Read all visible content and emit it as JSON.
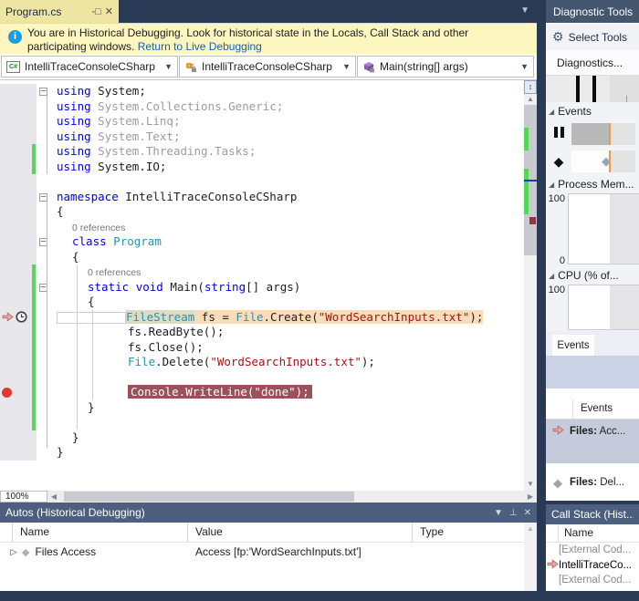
{
  "tab": {
    "title": "Program.cs",
    "pin_icon": "pin-icon",
    "close_icon": "close-icon"
  },
  "infobar": {
    "line1": "You are in Historical Debugging. Look for historical state in the Locals, Call Stack and other",
    "line2": "participating windows.",
    "link": "Return to Live Debugging",
    "icon": "info-icon"
  },
  "navbar": {
    "project": "IntelliTraceConsoleCSharp",
    "type": "IntelliTraceConsoleCSharp",
    "member": "Main(string[] args)"
  },
  "editor": {
    "zoom_label": "100%",
    "lines": [
      {
        "kind": "code",
        "ind": 0,
        "fold": true,
        "segs": [
          [
            "kw",
            "using"
          ],
          [
            "pl",
            " System;"
          ]
        ]
      },
      {
        "kind": "code",
        "ind": 0,
        "segs": [
          [
            "kw",
            "using"
          ],
          [
            "dim",
            " System.Collections.Generic;"
          ]
        ]
      },
      {
        "kind": "code",
        "ind": 0,
        "segs": [
          [
            "kw",
            "using"
          ],
          [
            "dim",
            " System.Linq;"
          ]
        ]
      },
      {
        "kind": "code",
        "ind": 0,
        "segs": [
          [
            "kw",
            "using"
          ],
          [
            "dim",
            " System.Text;"
          ]
        ]
      },
      {
        "kind": "code",
        "ind": 0,
        "bar": true,
        "segs": [
          [
            "kw",
            "using"
          ],
          [
            "dim",
            " System.Threading.Tasks;"
          ]
        ]
      },
      {
        "kind": "code",
        "ind": 0,
        "bar": true,
        "segs": [
          [
            "kw",
            "using"
          ],
          [
            "pl",
            " System.IO;"
          ]
        ]
      },
      {
        "kind": "blank"
      },
      {
        "kind": "code",
        "ind": 0,
        "fold": true,
        "segs": [
          [
            "kw",
            "namespace"
          ],
          [
            "pl",
            " IntelliTraceConsoleCSharp"
          ]
        ]
      },
      {
        "kind": "code",
        "ind": 0,
        "segs": [
          [
            "pl",
            "{"
          ]
        ]
      },
      {
        "kind": "lens",
        "ind": 17,
        "text": "0 references"
      },
      {
        "kind": "code",
        "ind": 17,
        "fold": true,
        "segs": [
          [
            "kw",
            "class"
          ],
          [
            "ty",
            " Program"
          ]
        ]
      },
      {
        "kind": "code",
        "ind": 17,
        "segs": [
          [
            "pl",
            "{"
          ]
        ]
      },
      {
        "kind": "lens",
        "ind": 34,
        "bar": true,
        "text": "0 references"
      },
      {
        "kind": "code",
        "ind": 34,
        "bar": true,
        "fold": true,
        "segs": [
          [
            "kw",
            "static"
          ],
          [
            "pl",
            " "
          ],
          [
            "kw",
            "void"
          ],
          [
            "pl",
            " Main("
          ],
          [
            "kw",
            "string"
          ],
          [
            "pl",
            "[] args)"
          ]
        ]
      },
      {
        "kind": "code",
        "ind": 34,
        "bar": true,
        "segs": [
          [
            "pl",
            "{"
          ]
        ]
      },
      {
        "kind": "code",
        "ind": 0,
        "bar": true,
        "margin": "hist",
        "hl": "hist",
        "box": 76,
        "segs": [
          [
            "tybox",
            "FileStream"
          ],
          [
            "pl",
            " fs = "
          ],
          [
            "ty",
            "File"
          ],
          [
            "pl",
            ".Create("
          ],
          [
            "str",
            "\"WordSearchInputs.txt\""
          ],
          [
            "pl",
            ");"
          ]
        ]
      },
      {
        "kind": "code",
        "ind": 78,
        "bar": true,
        "segs": [
          [
            "pl",
            "fs.ReadByte();"
          ]
        ]
      },
      {
        "kind": "code",
        "ind": 78,
        "bar": true,
        "segs": [
          [
            "pl",
            "fs.Close();"
          ]
        ]
      },
      {
        "kind": "code",
        "ind": 78,
        "bar": true,
        "segs": [
          [
            "ty",
            "File"
          ],
          [
            "pl",
            ".Delete("
          ],
          [
            "str",
            "\"WordSearchInputs.txt\""
          ],
          [
            "pl",
            ");"
          ]
        ]
      },
      {
        "kind": "blank",
        "bar": true
      },
      {
        "kind": "code",
        "ind": 78,
        "bar": true,
        "margin": "bp",
        "hl": "bp",
        "segs": [
          [
            "bp",
            "Console.WriteLine(\"done\");"
          ]
        ]
      },
      {
        "kind": "code",
        "ind": 34,
        "bar": true,
        "segs": [
          [
            "pl",
            "}"
          ]
        ]
      },
      {
        "kind": "blank",
        "bar": true
      },
      {
        "kind": "code",
        "ind": 17,
        "segs": [
          [
            "pl",
            "}"
          ]
        ]
      },
      {
        "kind": "code",
        "ind": 0,
        "segs": [
          [
            "pl",
            "}"
          ]
        ]
      }
    ]
  },
  "autos": {
    "title": "Autos (Historical Debugging)",
    "columns": [
      "Name",
      "Value",
      "Type"
    ],
    "rows": [
      {
        "name": "Files Access",
        "value": "Access [fp:'WordSearchInputs.txt']",
        "type": ""
      }
    ]
  },
  "diag": {
    "title": "Diagnostic Tools",
    "select_tools": "Select Tools",
    "session": "Diagnostics...",
    "events_header": "Events",
    "memory_header": "Process Mem...",
    "cpu_header": "CPU (% of...",
    "mem_max": "100",
    "mem_min": "0",
    "cpu_max": "100",
    "tab": "Events",
    "list_header": "Events",
    "events": [
      {
        "bold": "Files:",
        "rest": " Acc...",
        "icon": "intellitrace-current-event-icon",
        "selected": true
      },
      {
        "bold": "Files:",
        "rest": " Del...",
        "icon": "event-diamond-icon",
        "selected": false
      }
    ]
  },
  "callstack": {
    "title": "Call Stack (Hist...",
    "name_col": "Name",
    "rows": [
      {
        "text": "[External Cod...",
        "dim": true,
        "current": false
      },
      {
        "text": "IntelliTraceCo...",
        "dim": false,
        "current": true
      },
      {
        "text": "[External Cod...",
        "dim": true,
        "current": false
      }
    ]
  },
  "colors": {
    "historical_line": "#FCDCB8",
    "breakpoint_line": "#99515A",
    "breakpoint_dot": "#E0382C",
    "change_bar": "#59D659",
    "timeline_marker": "#E89D4C",
    "frame": "#2A3A55",
    "panel_title": "#4D5F7E"
  }
}
